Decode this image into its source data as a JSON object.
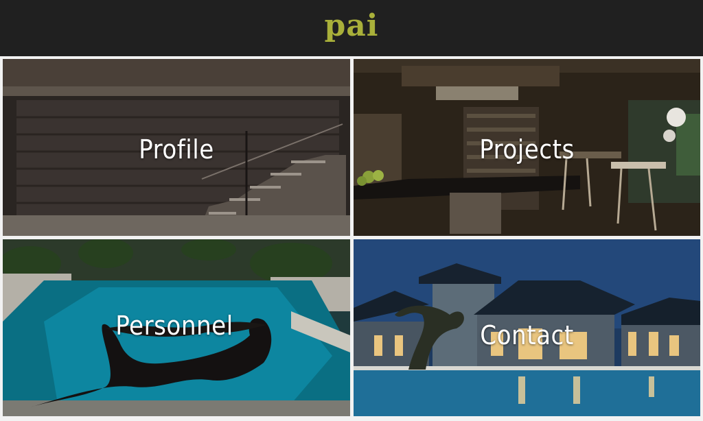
{
  "header": {
    "logo_text": "pai"
  },
  "tiles": [
    {
      "label": "Profile"
    },
    {
      "label": "Projects"
    },
    {
      "label": "Personnel"
    },
    {
      "label": "Contact"
    }
  ],
  "colors": {
    "header_bg": "#202020",
    "logo": "#a9b03a",
    "tile_border": "#f2f2f2",
    "label": "#ffffff"
  }
}
